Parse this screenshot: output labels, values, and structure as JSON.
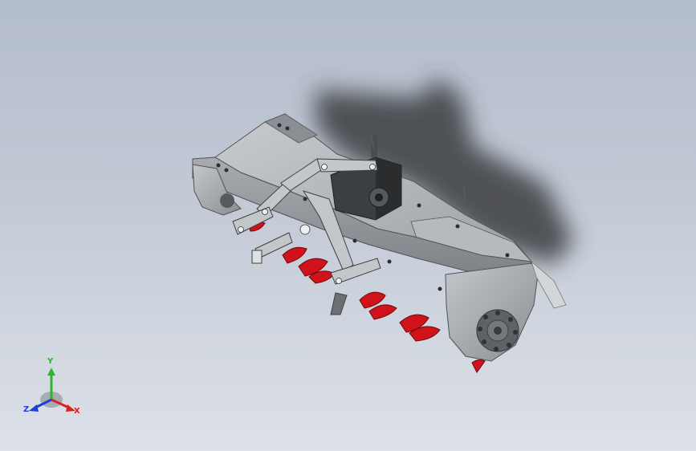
{
  "viewport": {
    "background_top": "#b3bccb",
    "background_bottom": "#dde1e8"
  },
  "model": {
    "subject": "rotary-tiller-assembly",
    "body_color": "#9ea2a6",
    "blade_color": "#d0121b",
    "gearbox_color": "#3c3f42"
  },
  "triad": {
    "y_label": "Y",
    "x_label": "X",
    "z_label": "Z",
    "y_color": "#2db52d",
    "x_color": "#d8231f",
    "z_color": "#1f3fd8"
  }
}
